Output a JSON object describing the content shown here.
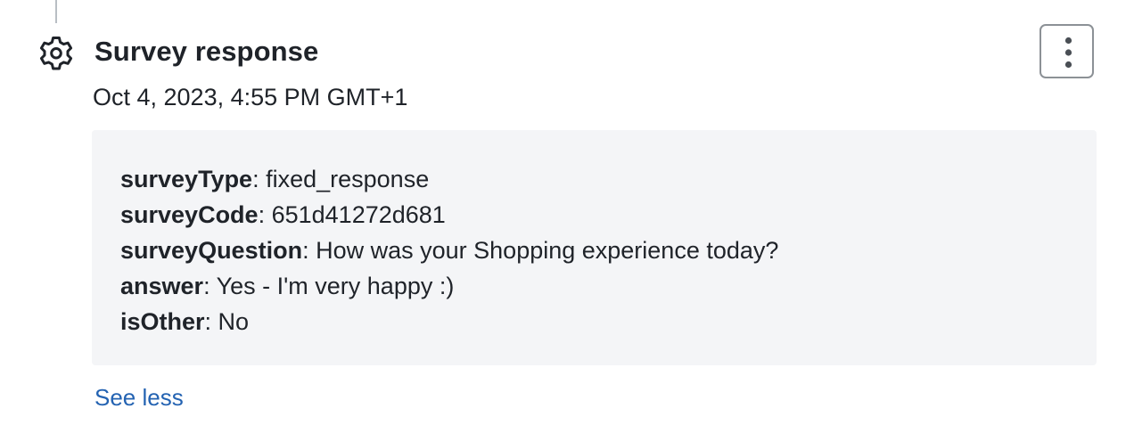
{
  "event": {
    "icon": "gear-icon",
    "title": "Survey response",
    "timestamp": "Oct 4, 2023, 4:55 PM GMT+1",
    "more_button_icon": "vertical-ellipsis-icon"
  },
  "details": [
    {
      "key": "surveyType",
      "separator": ":",
      "value": " fixed_response"
    },
    {
      "key": "surveyCode",
      "separator": ":",
      "value": " 651d41272d681"
    },
    {
      "key": "surveyQuestion",
      "separator": ":",
      "value": " How was your Shopping experience today?"
    },
    {
      "key": "answer",
      "separator": ":",
      "value": " Yes - I'm very happy :)"
    },
    {
      "key": "isOther",
      "separator": ":",
      "value": " No"
    }
  ],
  "see_less_label": "See less",
  "colors": {
    "text": "#1f2329",
    "link": "#2463b2",
    "details_background": "#f4f5f7",
    "border": "#8c9196"
  }
}
